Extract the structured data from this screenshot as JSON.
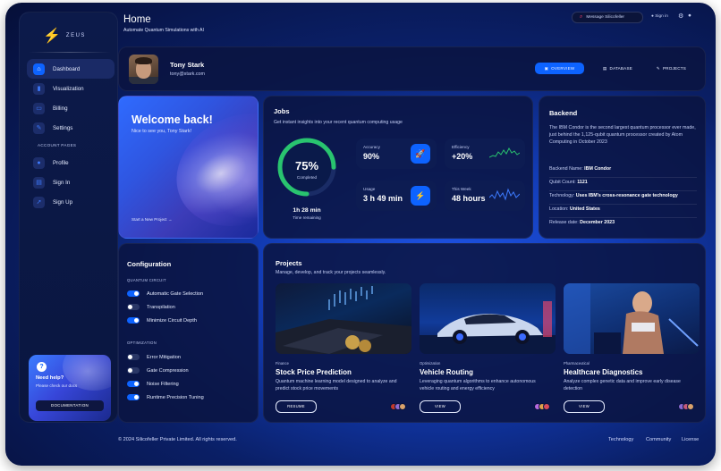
{
  "brand": {
    "name": "ZEUS"
  },
  "sidebar": {
    "items": [
      {
        "label": "Dashboard",
        "icon": "home-icon"
      },
      {
        "label": "Visualization",
        "icon": "chart-icon"
      },
      {
        "label": "Billing",
        "icon": "card-icon"
      },
      {
        "label": "Settings",
        "icon": "wrench-icon"
      }
    ],
    "account_heading": "ACCOUNT PAGES",
    "account_items": [
      {
        "label": "Profile",
        "icon": "person-icon"
      },
      {
        "label": "Sign In",
        "icon": "document-icon"
      },
      {
        "label": "Sign Up",
        "icon": "rocket-icon"
      }
    ],
    "help": {
      "title": "Need help?",
      "subtitle": "Please check our docs",
      "button": "DOCUMENTATION"
    }
  },
  "header": {
    "title": "Home",
    "subtitle": "Automate Quantum Simulations with AI",
    "search_placeholder": "Message Silicofeller",
    "signin": "Sign in"
  },
  "profile": {
    "name": "Tony Stark",
    "email": "tony@stark.com",
    "tabs": [
      "OVERVIEW",
      "DATABASE",
      "PROJECTS"
    ]
  },
  "welcome": {
    "title": "Welcome back!",
    "subtitle": "Nice to see you, Tony Stark!",
    "link": "Start a New Project →"
  },
  "jobs": {
    "title": "Jobs",
    "subtitle": "Get instant insights into your recent quantum computing usage",
    "progress": {
      "value": "75%",
      "fraction": 0.75,
      "label": "Completed"
    },
    "time": {
      "value": "1h 28 min",
      "label": "Time remaining"
    },
    "stats": [
      {
        "label": "Accuracy",
        "value": "90%",
        "icon": "rocket-icon"
      },
      {
        "label": "Efficiency",
        "value": "+20%",
        "icon": "sparkline-icon"
      },
      {
        "label": "Usage",
        "value": "3 h 49 min",
        "icon": "bolt-icon"
      },
      {
        "label": "This Week",
        "value": "48 hours",
        "icon": "sparkline-icon"
      }
    ]
  },
  "backend": {
    "title": "Backend",
    "description": "The IBM Condor is the second largest quantum processor ever made, just behind the 1,125-qubit quantum processor created by Atom Computing in October 2023",
    "rows": [
      {
        "label": "Backend Name:",
        "value": "IBM Condor"
      },
      {
        "label": "Qubit Count:",
        "value": "1121"
      },
      {
        "label": "Technology:",
        "value": "Uses IBM's cross-resonance gate technology"
      },
      {
        "label": "Location:",
        "value": "United States"
      },
      {
        "label": "Release date:",
        "value": "December 2023"
      }
    ]
  },
  "configuration": {
    "title": "Configuration",
    "sections": [
      {
        "heading": "QUANTUM CIRCUIT",
        "toggles": [
          {
            "label": "Automatic Gate Selection",
            "on": true
          },
          {
            "label": "Transpilation",
            "on": false
          },
          {
            "label": "Minimize Circuit Depth",
            "on": true
          }
        ]
      },
      {
        "heading": "OPTIMIZATION",
        "toggles": [
          {
            "label": "Error Mitigation",
            "on": false
          },
          {
            "label": "Gate Compression",
            "on": false
          },
          {
            "label": "Noise Filtering",
            "on": true
          },
          {
            "label": "Runtime Precision Tuning",
            "on": true
          }
        ]
      }
    ]
  },
  "projects": {
    "title": "Projects",
    "subtitle": "Manage, develop, and track your projects seamlessly.",
    "cards": [
      {
        "category": "Finance",
        "title": "Stock Price Prediction",
        "description": "Quantum machine learning model designed to analyze and predict stock price movements",
        "button": "RESUME"
      },
      {
        "category": "Optimization",
        "title": "Vehicle Routing",
        "description": "Leveraging quantum algorithms to enhance autonomous vehicle routing and energy efficiency",
        "button": "VIEW"
      },
      {
        "category": "Pharmaceutical",
        "title": "Healthcare Diagnostics",
        "description": "Analyze complex genetic data and improve early disease detection",
        "button": "VIEW"
      }
    ]
  },
  "footer": {
    "copyright": "© 2024 Silicofeller Private Limited. All rights reserved.",
    "links": [
      "Technology",
      "Community",
      "License"
    ]
  },
  "colors": {
    "accent": "#0d63ff",
    "brand": "#ffd400",
    "spark": "#29c46f"
  }
}
